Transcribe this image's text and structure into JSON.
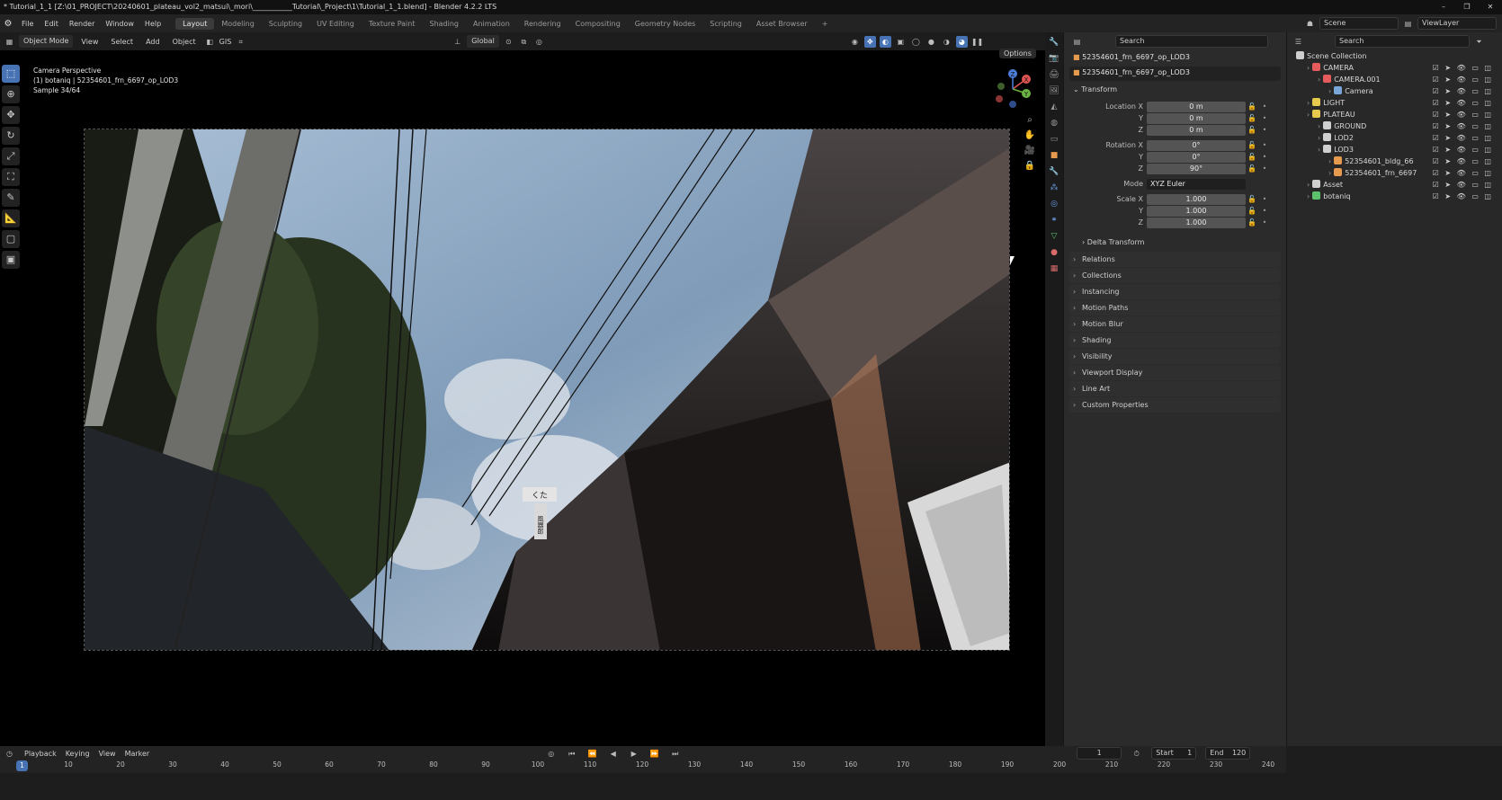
{
  "window": {
    "title": "* Tutorial_1_1 [Z:\\01_PROJECT\\20240601_plateau_vol2_matsui\\_mori\\___________Tutorial\\_Project\\1\\Tutorial_1_1.blend] - Blender 4.2.2 LTS",
    "controls": [
      "–",
      "❐",
      "✕"
    ]
  },
  "menu": {
    "items": [
      "File",
      "Edit",
      "Render",
      "Window",
      "Help"
    ],
    "workspaces": [
      "Layout",
      "Modeling",
      "Sculpting",
      "UV Editing",
      "Texture Paint",
      "Shading",
      "Animation",
      "Rendering",
      "Compositing",
      "Geometry Nodes",
      "Scripting",
      "Asset Browser"
    ],
    "active_workspace": "Layout",
    "add_tab": "+",
    "scene_label": "Scene",
    "viewlayer_label": "ViewLayer"
  },
  "viewport": {
    "mode": "Object Mode",
    "menus": [
      "View",
      "Select",
      "Add",
      "Object"
    ],
    "gis": "GIS",
    "transform_orientation": "Global",
    "options": "Options",
    "overlay": {
      "line1": "Camera Perspective",
      "line2": "(1) botaniq | 52354601_frn_6697_op_LOD3",
      "line3": "Sample 34/64"
    },
    "gizmo": {
      "x": "X",
      "y": "Y",
      "z": "Z"
    },
    "render_sign": {
      "a": "くた",
      "b": "風器郎"
    }
  },
  "properties": {
    "search_placeholder": "Search",
    "object_name": "52354601_frn_6697_op_LOD3",
    "data_name": "52354601_frn_6697_op_LOD3",
    "transform_title": "Transform",
    "location_label": "Location X",
    "location": [
      "0 m",
      "0 m",
      "0 m"
    ],
    "rotation_label": "Rotation X",
    "rotation": [
      "0°",
      "0°",
      "90°"
    ],
    "mode_label": "Mode",
    "mode_value": "XYZ Euler",
    "scale_label": "Scale X",
    "scale": [
      "1.000",
      "1.000",
      "1.000"
    ],
    "y_label": "Y",
    "z_label": "Z",
    "delta": "Delta Transform",
    "panels": [
      "Relations",
      "Collections",
      "Instancing",
      "Motion Paths",
      "Motion Blur",
      "Shading",
      "Visibility",
      "Viewport Display",
      "Line Art",
      "Custom Properties"
    ]
  },
  "outliner": {
    "search_placeholder": "Search",
    "root": "Scene Collection",
    "items": [
      {
        "name": "CAMERA",
        "indent": 1,
        "color": "#e65c5c"
      },
      {
        "name": "CAMERA.001",
        "indent": 2,
        "color": "#e65c5c"
      },
      {
        "name": "Camera",
        "indent": 3,
        "color": "#7aa7d9"
      },
      {
        "name": "LIGHT",
        "indent": 1,
        "color": "#e6c94d"
      },
      {
        "name": "PLATEAU",
        "indent": 1,
        "color": "#e6c94d"
      },
      {
        "name": "GROUND",
        "indent": 2,
        "color": "#cfcfcf"
      },
      {
        "name": "LOD2",
        "indent": 2,
        "color": "#cfcfcf"
      },
      {
        "name": "LOD3",
        "indent": 2,
        "color": "#cfcfcf"
      },
      {
        "name": "52354601_bldg_66",
        "indent": 3,
        "color": "#e69a4d"
      },
      {
        "name": "52354601_frn_6697",
        "indent": 3,
        "color": "#e69a4d"
      },
      {
        "name": "Asset",
        "indent": 1,
        "color": "#cfcfcf"
      },
      {
        "name": "botaniq",
        "indent": 1,
        "color": "#5cc26b"
      }
    ]
  },
  "timeline": {
    "menus": [
      "Playback",
      "Keying",
      "View",
      "Marker"
    ],
    "current_frame": "1",
    "start_label": "Start",
    "start": "1",
    "end_label": "End",
    "end": "120",
    "ticks": [
      "10",
      "20",
      "30",
      "40",
      "50",
      "60",
      "70",
      "80",
      "90",
      "100",
      "110",
      "120",
      "130",
      "140",
      "150",
      "160",
      "170",
      "180",
      "190",
      "200",
      "210",
      "220",
      "230",
      "240"
    ],
    "playhead": "1"
  }
}
